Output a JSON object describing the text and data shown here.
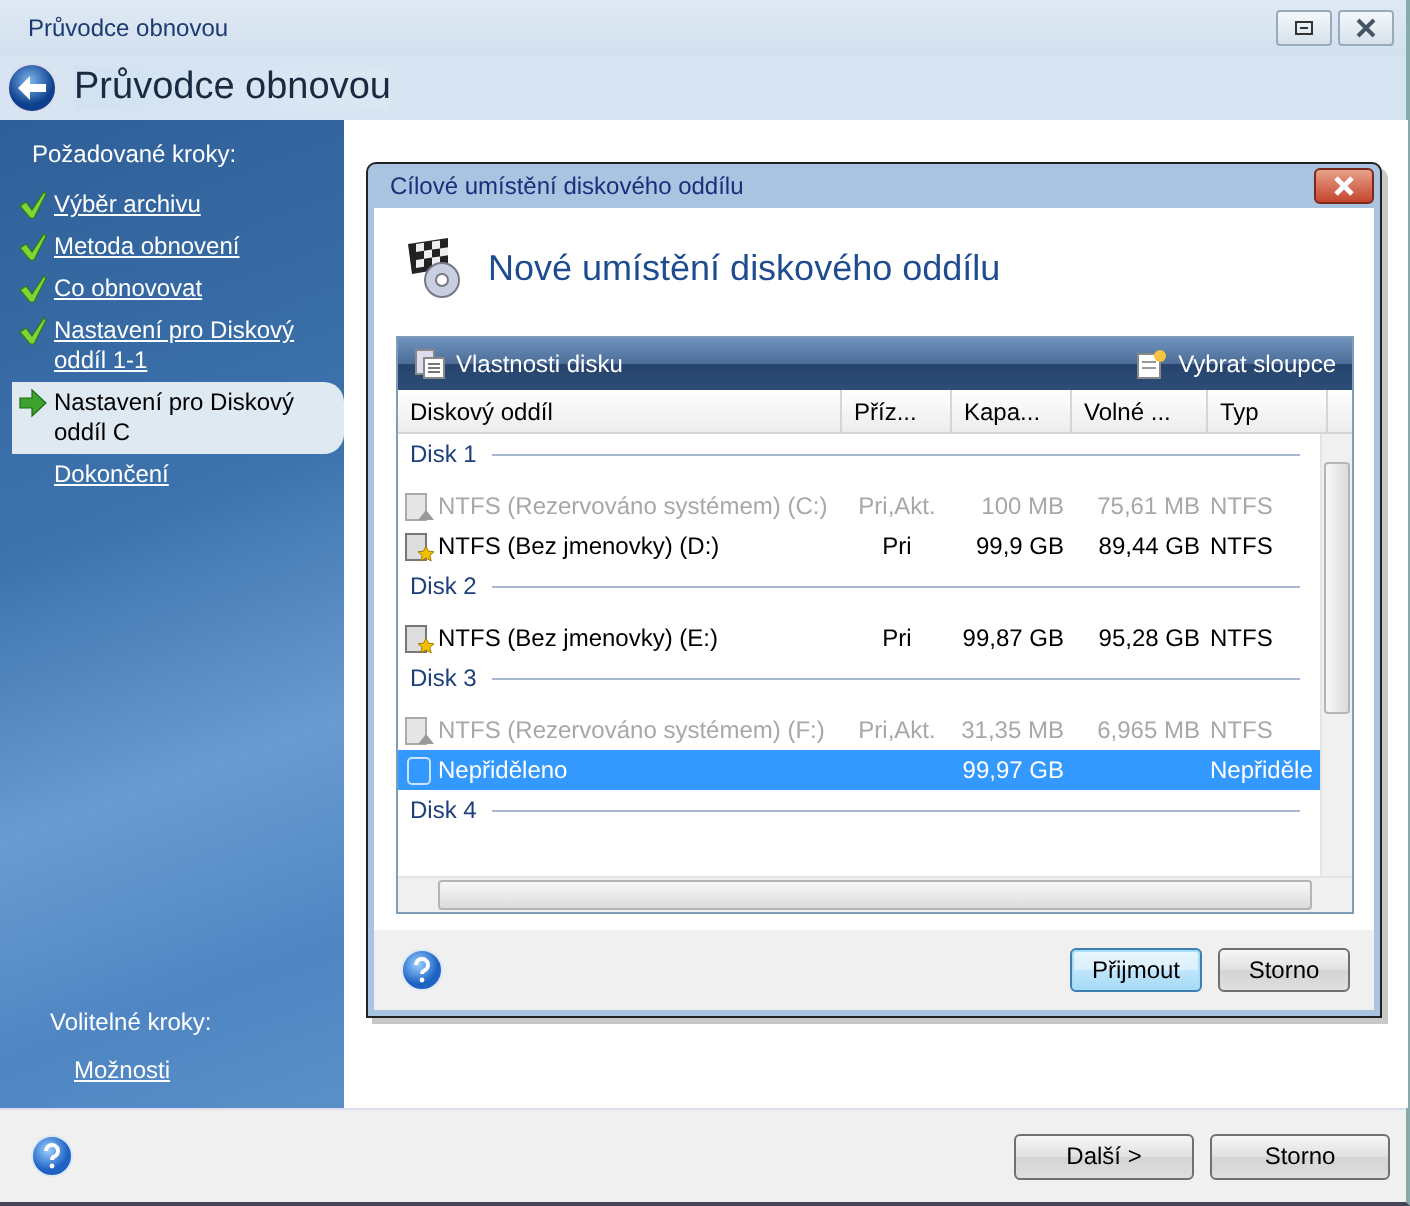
{
  "window": {
    "title": "Průvodce obnovou",
    "header": "Průvodce obnovou"
  },
  "sidebar": {
    "heading": "Požadované kroky:",
    "steps": [
      {
        "label": "Výběr archivu",
        "done": true,
        "selected": false
      },
      {
        "label": "Metoda obnovení",
        "done": true,
        "selected": false
      },
      {
        "label": "Co obnovovat",
        "done": true,
        "selected": false
      },
      {
        "label": "Nastavení pro Diskový oddíl 1-1",
        "done": true,
        "selected": false
      },
      {
        "label": "Nastavení pro Diskový oddíl C",
        "done": false,
        "selected": true
      },
      {
        "label": "Dokončení",
        "done": false,
        "selected": false
      }
    ],
    "optional_heading": "Volitelné kroky:",
    "optional_steps": [
      {
        "label": "Možnosti"
      }
    ]
  },
  "dialog": {
    "title": "Cílové umístění diskového oddílu",
    "heading": "Nové umístění diskového oddílu",
    "toolbar": {
      "left": "Vlastnosti disku",
      "right": "Vybrat sloupce"
    },
    "columns": [
      "Diskový oddíl",
      "Příz...",
      "Kapa...",
      "Volné ...",
      "Typ"
    ],
    "rows": [
      {
        "kind": "group",
        "label": "Disk 1"
      },
      {
        "kind": "partition",
        "name": "NTFS (Rezervováno systémem) (C:)",
        "flags": "Pri,Akt.",
        "capacity": "100 MB",
        "free": "75,61 MB",
        "type": "NTFS",
        "disabled": true,
        "selected": false
      },
      {
        "kind": "partition",
        "name": "NTFS (Bez jmenovky) (D:)",
        "flags": "Pri",
        "capacity": "99,9 GB",
        "free": "89,44 GB",
        "type": "NTFS",
        "disabled": false,
        "selected": false
      },
      {
        "kind": "group",
        "label": "Disk 2"
      },
      {
        "kind": "partition",
        "name": "NTFS (Bez jmenovky) (E:)",
        "flags": "Pri",
        "capacity": "99,87 GB",
        "free": "95,28 GB",
        "type": "NTFS",
        "disabled": false,
        "selected": false
      },
      {
        "kind": "group",
        "label": "Disk 3"
      },
      {
        "kind": "partition",
        "name": "NTFS (Rezervováno systémem) (F:)",
        "flags": "Pri,Akt.",
        "capacity": "31,35 MB",
        "free": "6,965 MB",
        "type": "NTFS",
        "disabled": true,
        "selected": false
      },
      {
        "kind": "unallocated",
        "name": "Nepřiděleno",
        "capacity": "99,97 GB",
        "type": "Nepřiděle",
        "disabled": false,
        "selected": true
      },
      {
        "kind": "group",
        "label": "Disk 4"
      }
    ],
    "buttons": [
      "Přijmout",
      "Storno"
    ]
  },
  "footer": {
    "buttons": [
      "Další >",
      "Storno"
    ]
  }
}
